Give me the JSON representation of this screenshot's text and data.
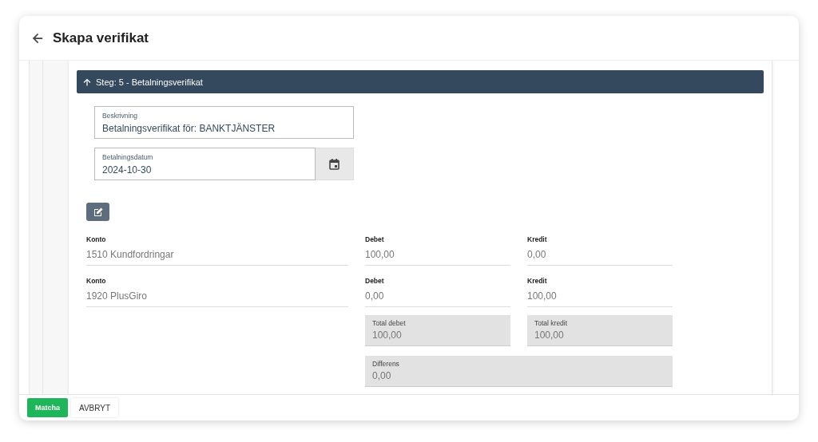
{
  "header": {
    "title": "Skapa verifikat"
  },
  "step": {
    "label": "Steg: 5 - Betalningsverifikat",
    "expanded": true
  },
  "description": {
    "label": "Beskrivning",
    "value": "Betalningsverifikat för: BANKTJÄNSTER"
  },
  "date": {
    "label": "Betalningsdatum",
    "value": "2024-10-30"
  },
  "lines": [
    {
      "account_label": "Konto",
      "account": "1510 Kundfordringar",
      "debit_label": "Debet",
      "debit": "100,00",
      "credit_label": "Kredit",
      "credit": "0,00"
    },
    {
      "account_label": "Konto",
      "account": "1920 PlusGiro",
      "debit_label": "Debet",
      "debit": "0,00",
      "credit_label": "Kredit",
      "credit": "100,00"
    }
  ],
  "totals": {
    "debit_label": "Total debet",
    "debit": "100,00",
    "credit_label": "Total kredit",
    "credit": "100,00",
    "difference_label": "Differens",
    "difference": "0,00"
  },
  "footer": {
    "buttons": [
      {
        "label": "Matcha",
        "kind": "primary"
      },
      {
        "label": "AVBRYT",
        "kind": "secondary"
      }
    ]
  }
}
